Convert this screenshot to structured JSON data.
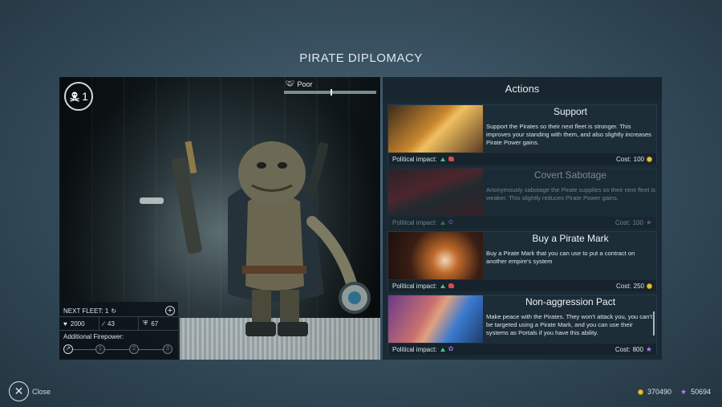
{
  "screen": {
    "title": "PIRATE DIPLOMACY"
  },
  "portrait": {
    "level": "1",
    "standing_label": "Poor",
    "standing_level_fraction": 0.5
  },
  "fleet": {
    "next_fleet_label": "NEXT FLEET: 1",
    "health": "2000",
    "attack": "43",
    "defense": "67",
    "additional_firepower_label": "Additional Firepower:",
    "firepower_steps": [
      "1",
      "2",
      "3"
    ]
  },
  "actions": {
    "title": "Actions",
    "political_impact_label": "Political impact:",
    "cost_label": "Cost:",
    "items": [
      {
        "name": "Support",
        "description": "Support the Pirates so their next fleet is stronger. This improves your standing with them, and also slightly increases Pirate Power gains.",
        "cost": "100",
        "currency": "credits",
        "enabled": true
      },
      {
        "name": "Covert Sabotage",
        "description": "Anonymously sabotage the Pirate supplies so their next fleet is weaker. This slightly reduces Pirate Power gains.",
        "cost": "100",
        "currency": "influence",
        "enabled": false
      },
      {
        "name": "Buy a Pirate Mark",
        "description": "Buy a Pirate Mark that you can use to put a contract on another empire's system",
        "cost": "250",
        "currency": "credits",
        "enabled": true
      },
      {
        "name": "Non-aggression Pact",
        "description": "Make peace with the Pirates. They won't attack you, you can't be targeted using a Pirate Mark, and you can use their systems as Portals if you have this ability.",
        "cost": "800",
        "currency": "influence",
        "enabled": true
      }
    ]
  },
  "footer": {
    "close_label": "Close",
    "credits": "370490",
    "influence": "50694"
  },
  "colors": {
    "credits": "#e6c23a",
    "influence": "#b57cf5",
    "military": "#d84a4a",
    "positive": "#40c88a"
  }
}
